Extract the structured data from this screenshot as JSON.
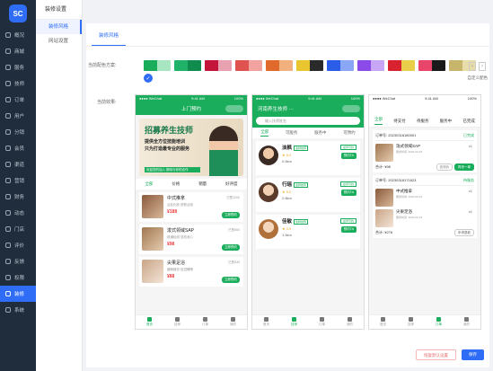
{
  "sidebar": {
    "logo": "SC",
    "items": [
      {
        "label": "概况",
        "active": false
      },
      {
        "label": "商城",
        "active": false
      },
      {
        "label": "服务",
        "active": false
      },
      {
        "label": "技师",
        "active": false
      },
      {
        "label": "订单",
        "active": false
      },
      {
        "label": "用户",
        "active": false
      },
      {
        "label": "分销",
        "active": false
      },
      {
        "label": "会员",
        "active": false
      },
      {
        "label": "渠道",
        "active": false
      },
      {
        "label": "营销",
        "active": false
      },
      {
        "label": "财务",
        "active": false
      },
      {
        "label": "动态",
        "active": false
      },
      {
        "label": "门店",
        "active": false
      },
      {
        "label": "评价",
        "active": false
      },
      {
        "label": "反馈",
        "active": false
      },
      {
        "label": "权限",
        "active": false
      },
      {
        "label": "装修",
        "active": true
      },
      {
        "label": "系统",
        "active": false
      }
    ]
  },
  "subside": {
    "title": "装修设置",
    "items": [
      {
        "label": "装修风格",
        "active": true
      },
      {
        "label": "网站设置",
        "active": false
      }
    ]
  },
  "main": {
    "tab": "装修风格",
    "color_label": "当前配色方案:",
    "preview_label": "当前效果:",
    "custom_link": "自定义配色",
    "reset_button": "恢复默认设置",
    "save_button": "保存",
    "swatches": [
      [
        "#1aad5b",
        "#a8e6c2"
      ],
      [
        "#21b26a",
        "#118c4f"
      ],
      [
        "#c4153a",
        "#e8a1b0"
      ],
      [
        "#e0524f",
        "#f2a39f"
      ],
      [
        "#e06a2c",
        "#f2b07f"
      ],
      [
        "#e9c52f",
        "#2a2a2a"
      ],
      [
        "#2c5de8",
        "#8aa7f5"
      ],
      [
        "#8a4be8",
        "#c7a6f5"
      ],
      [
        "#d8222f",
        "#e9ce4a"
      ],
      [
        "#e9446a",
        "#1a1a1a"
      ],
      [
        "#c7b56b",
        "#e8dca8"
      ]
    ]
  },
  "phone1": {
    "status_left": "●●●● WeChat",
    "status_mid": "9:41 AM",
    "status_right": "100%",
    "title": "上门预约",
    "banner_title": "招募养生技师",
    "banner_line1": "提供全方位技能培训",
    "banner_line2": "只为打造最专业的服务",
    "banner_bar": "欢迎您的加入 期待与你的合作",
    "filter": [
      "全部",
      "价格",
      "销量",
      "好评度"
    ],
    "items": [
      {
        "name": "中式推拿",
        "price": "¥188",
        "old": "¥288",
        "sub": "活血化瘀 舒筋活络",
        "meta": "已售1200",
        "btn": "立即预约"
      },
      {
        "name": "泼式领域SAP",
        "price": "¥98",
        "old": "¥128",
        "sub": "疏通经络 放松身心",
        "meta": "已售860",
        "btn": "立即预约"
      },
      {
        "name": "尖果足浴",
        "price": "¥88",
        "old": "¥128",
        "sub": "缓解疲劳 促进睡眠",
        "meta": "已售530",
        "btn": "立即预约"
      }
    ],
    "tabbar": [
      "首页",
      "技师",
      "订单",
      "我的"
    ]
  },
  "phone2": {
    "status_left": "●●●● WeChat",
    "status_mid": "9:41 AM",
    "status_right": "100%",
    "title": "河南养生技师 ⋯",
    "search": "输入技师姓名",
    "tabs": [
      "全部",
      "可服务",
      "服务中",
      "可预约"
    ],
    "techs": [
      {
        "name": "淡枫",
        "tag": "金牌技师",
        "rating": "★ 5.0",
        "dist": "0.5km",
        "ev": "最早可约",
        "btn": "预约TA"
      },
      {
        "name": "行瑶",
        "tag": "金牌技师",
        "rating": "★ 5.0",
        "dist": "2.8km",
        "ev": "最早可约",
        "btn": "预约TA"
      },
      {
        "name": "佳敏",
        "tag": "金牌技师",
        "rating": "★ 4.9",
        "dist": "1.5km",
        "ev": "最早可约",
        "btn": "预约TA"
      }
    ],
    "tabbar": [
      "首页",
      "技师",
      "订单",
      "我的"
    ]
  },
  "phone3": {
    "status_left": "●●●● WeChat",
    "status_mid": "9:41 AM",
    "status_right": "100%",
    "tabs": [
      "全部",
      "待支付",
      "待服务",
      "服务中",
      "已完成"
    ],
    "orders": [
      {
        "no": "订单号: 20230318180001",
        "status": "已完成",
        "name": "泼式领域SAP",
        "sub": "服务时间: 2023-03-18",
        "qty": "x1",
        "total": "合计: ¥98",
        "btn1": "去评价",
        "btn2": "再来一单"
      },
      {
        "no": "订单号: 20230318171623",
        "status": "待服务",
        "name": "中式推拿",
        "sub": "服务时间: 2023-03-19",
        "qty": "x1",
        "name2": "尖果足浴",
        "sub2": "服务时间: 2023-03-19",
        "qty2": "x1",
        "total": "合计: ¥276",
        "btn1": "申请退款",
        "btn2": ""
      }
    ],
    "tabbar": [
      "首页",
      "技师",
      "订单",
      "我的"
    ]
  }
}
